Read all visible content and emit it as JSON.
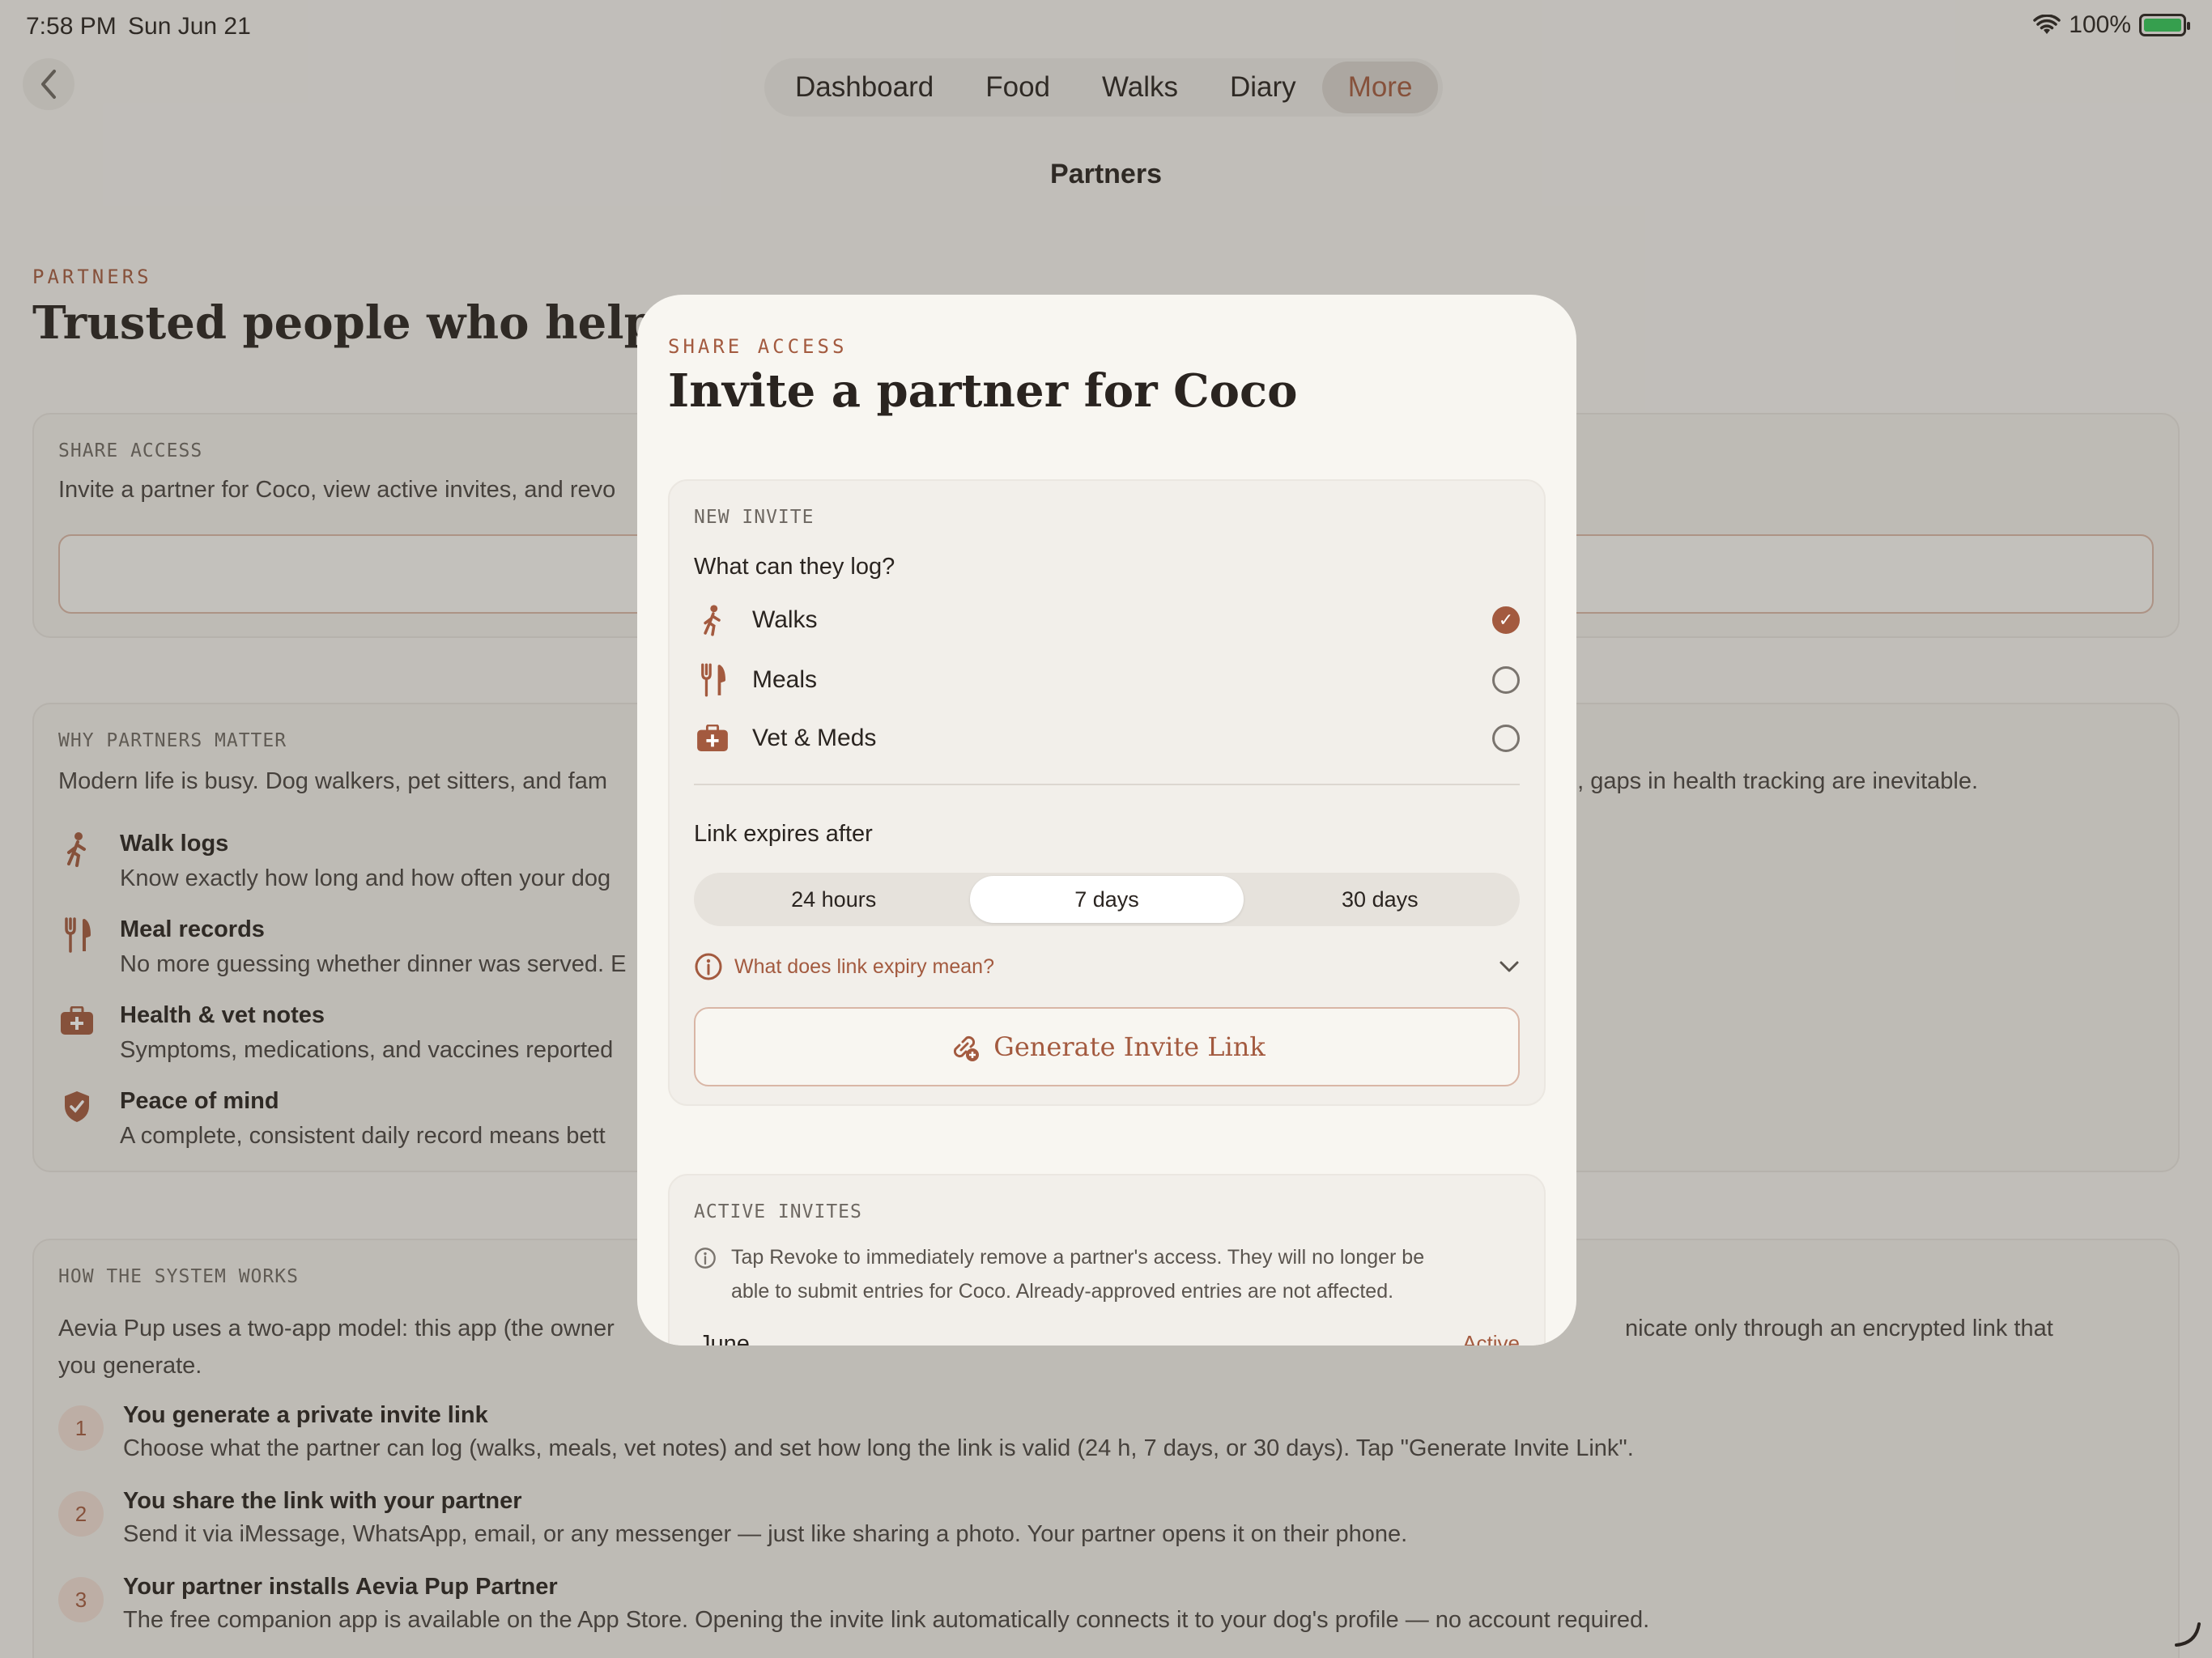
{
  "status_bar": {
    "time": "7:58 PM",
    "date": "Sun Jun 21",
    "battery": "100%"
  },
  "nav": {
    "tabs": [
      "Dashboard",
      "Food",
      "Walks",
      "Diary",
      "More"
    ],
    "active_tab": "More",
    "page_title": "Partners"
  },
  "background": {
    "eyebrow": "PARTNERS",
    "heading": "Trusted people who help care",
    "share_card": {
      "label": "SHARE ACCESS",
      "text": "Invite a partner for Coco, view active invites, and revo"
    },
    "why_card": {
      "label": "WHY PARTNERS MATTER",
      "intro_left": "Modern life is busy. Dog walkers, pet sitters, and fam",
      "intro_right": "d, gaps in health tracking are inevitable.",
      "features": [
        {
          "icon": "walk-icon",
          "title": "Walk logs",
          "desc": "Know exactly how long and how often your dog"
        },
        {
          "icon": "fork-knife-icon",
          "title": "Meal records",
          "desc": "No more guessing whether dinner was served. E"
        },
        {
          "icon": "medical-kit-icon",
          "title": "Health & vet notes",
          "desc": "Symptoms, medications, and vaccines reported"
        },
        {
          "icon": "shield-check-icon",
          "title": "Peace of mind",
          "desc": "A complete, consistent daily record means bett"
        }
      ]
    },
    "how_card": {
      "label": "HOW THE SYSTEM WORKS",
      "intro_line1_left": "Aevia Pup uses a two-app model: this app (the owner",
      "intro_line1_right": "nicate only through an encrypted link that",
      "intro_line2": "you generate.",
      "steps": [
        {
          "num": "1",
          "title": "You generate a private invite link",
          "desc": "Choose what the partner can log (walks, meals, vet notes) and set how long the link is valid (24 h, 7 days, or 30 days). Tap \"Generate Invite Link\"."
        },
        {
          "num": "2",
          "title": "You share the link with your partner",
          "desc": "Send it via iMessage, WhatsApp, email, or any messenger — just like sharing a photo. Your partner opens it on their phone."
        },
        {
          "num": "3",
          "title": "Your partner installs Aevia Pup Partner",
          "desc": "The free companion app is available on the App Store. Opening the invite link automatically connects it to your dog's profile — no account required."
        }
      ]
    }
  },
  "modal": {
    "eyebrow": "SHARE ACCESS",
    "title": "Invite a partner for Coco",
    "new_invite": {
      "label": "NEW INVITE",
      "question": "What can they log?",
      "options": [
        {
          "icon": "walk-icon",
          "label": "Walks",
          "checked": true
        },
        {
          "icon": "fork-knife-icon",
          "label": "Meals",
          "checked": false
        },
        {
          "icon": "medical-kit-icon",
          "label": "Vet & Meds",
          "checked": false
        }
      ],
      "expiry_label": "Link expires after",
      "expiry_options": [
        "24 hours",
        "7 days",
        "30 days"
      ],
      "expiry_selected": "7 days",
      "expiry_help": "What does link expiry mean?",
      "generate_button": "Generate Invite Link"
    },
    "active_invites": {
      "label": "ACTIVE INVITES",
      "info_line1": "Tap Revoke to immediately remove a partner's access. They will no longer be",
      "info_line2": "able to submit entries for Coco. Already-approved entries are not affected.",
      "first_row_name": "June",
      "first_row_status": "Active"
    }
  },
  "colors": {
    "accent": "#a35a3f",
    "background": "#f4f2ee",
    "modal": "#f8f6f1"
  }
}
